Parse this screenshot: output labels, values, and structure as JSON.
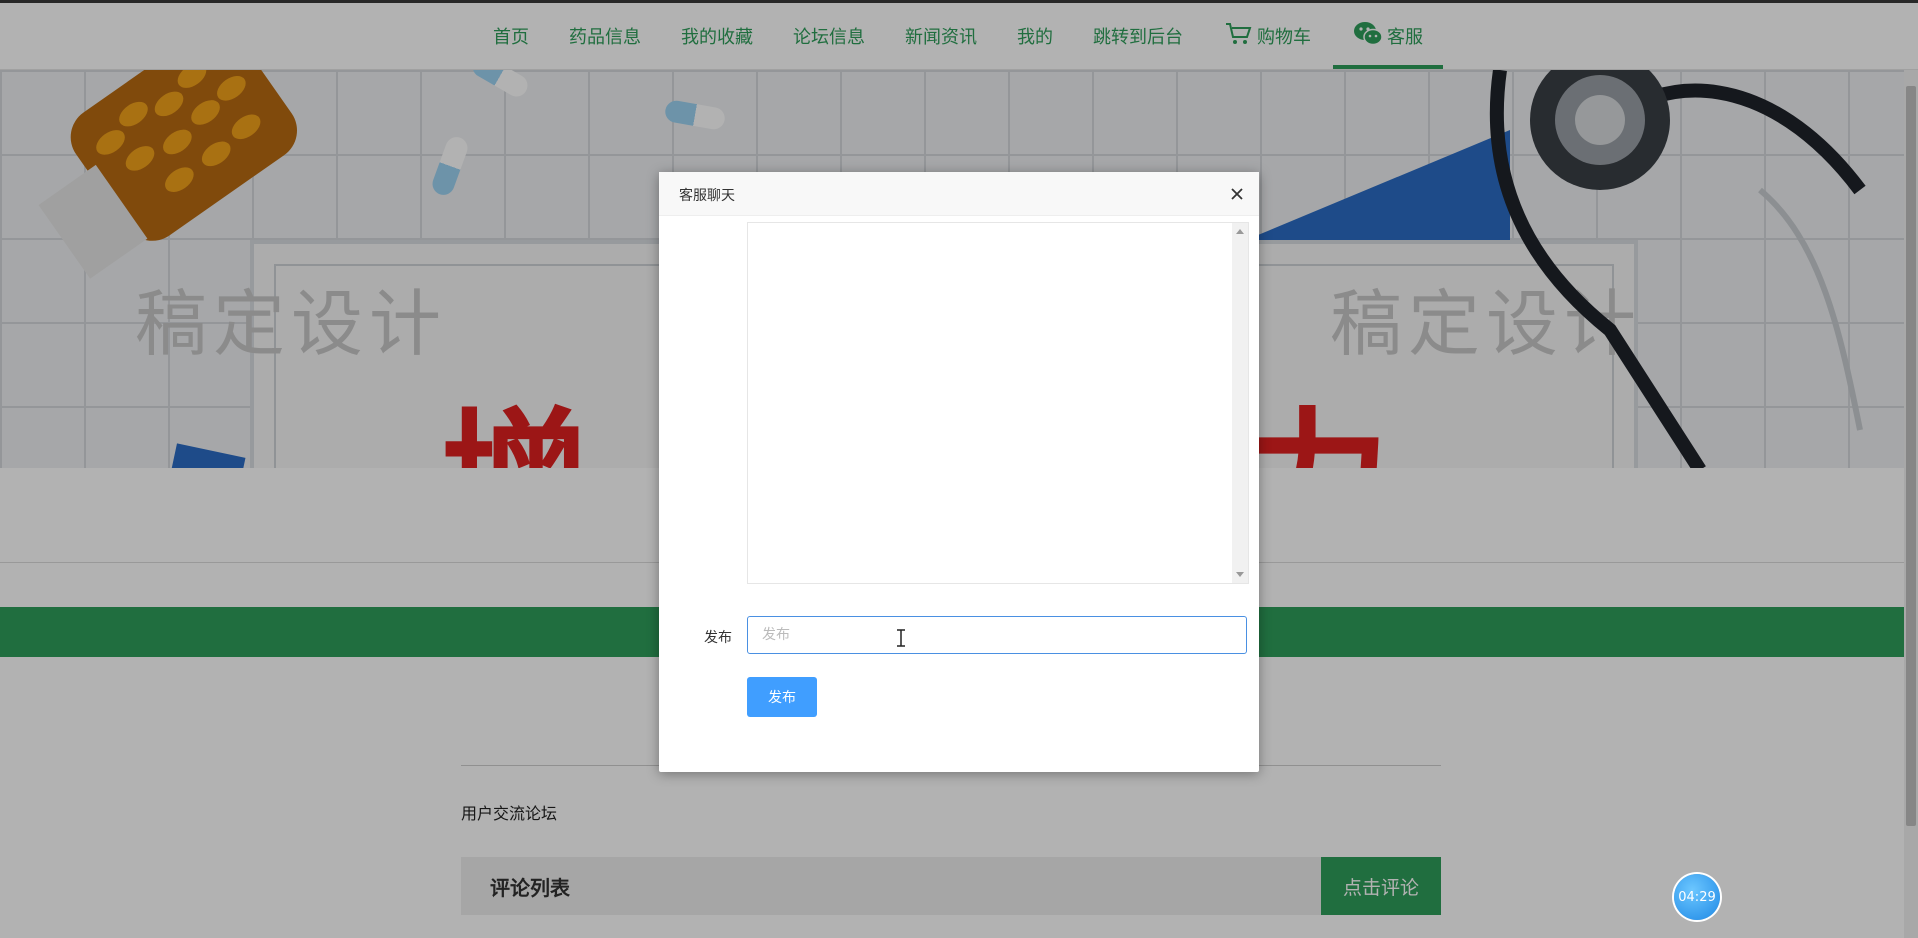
{
  "nav": {
    "items": [
      {
        "label": "首页"
      },
      {
        "label": "药品信息"
      },
      {
        "label": "我的收藏"
      },
      {
        "label": "论坛信息"
      },
      {
        "label": "新闻资讯"
      },
      {
        "label": "我的"
      },
      {
        "label": "跳转到后台"
      }
    ],
    "cart": {
      "label": "购物车",
      "icon": "cart-icon"
    },
    "service": {
      "label": "客服",
      "icon": "wechat-icon",
      "active": true
    }
  },
  "banner": {
    "watermark_left": "稿定设计",
    "watermark_right": "稿定设计",
    "big_text_left": "增",
    "big_text_right": "力"
  },
  "forum": {
    "title": "用户交流论坛",
    "comment_list_title": "评论列表",
    "comment_button": "点击评论"
  },
  "dialog": {
    "title": "客服聊天",
    "close_icon": "close-icon",
    "post_label": "发布",
    "post_placeholder": "发布",
    "post_value": "",
    "submit_label": "发布"
  },
  "timer": {
    "value": "04:29"
  },
  "colors": {
    "brand_green": "#2f9e5b",
    "primary_blue": "#409eff",
    "overlay": "rgba(0,0,0,0.30)"
  }
}
